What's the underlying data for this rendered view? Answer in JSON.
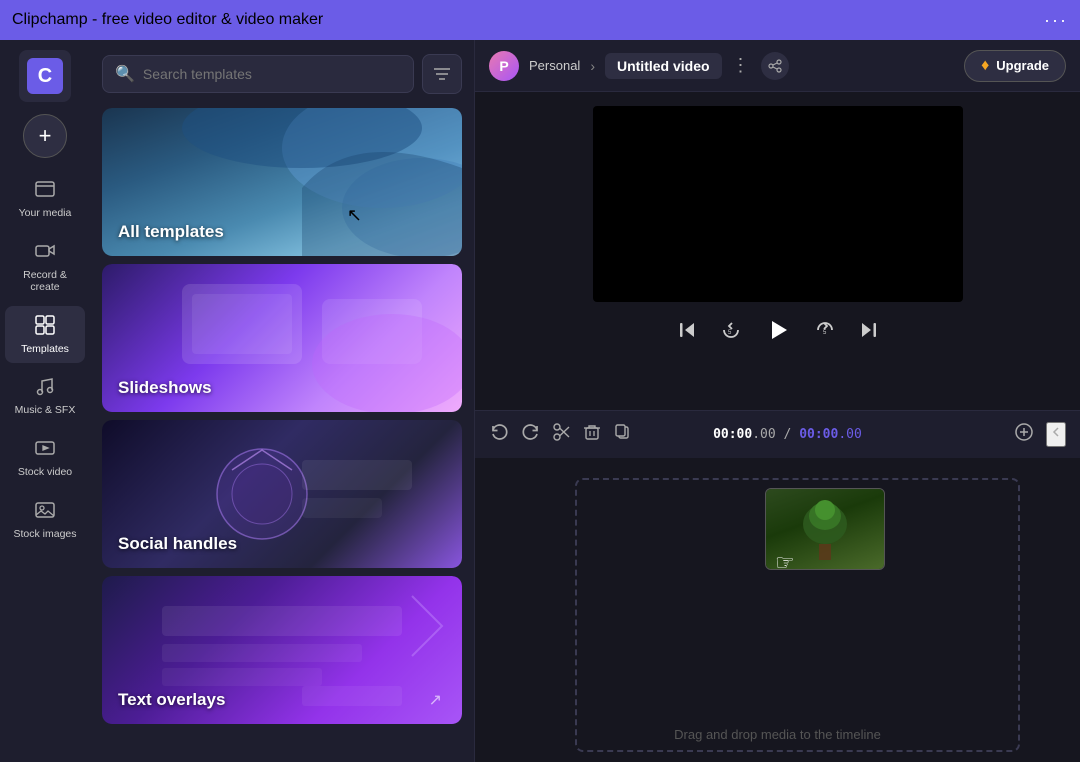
{
  "titlebar": {
    "title": "Clipchamp - free video editor & video maker",
    "dots": "···"
  },
  "sidebar": {
    "logo_letter": "C",
    "create_label": "+",
    "items": [
      {
        "id": "your-media",
        "icon": "🗂",
        "label": "Your media"
      },
      {
        "id": "record-create",
        "icon": "🎬",
        "label": "Record &\ncreate"
      },
      {
        "id": "templates",
        "icon": "⊞",
        "label": "Templates",
        "active": true
      },
      {
        "id": "music-sfx",
        "icon": "♪",
        "label": "Music & SFX"
      },
      {
        "id": "stock-video",
        "icon": "🎞",
        "label": "Stock video"
      },
      {
        "id": "stock-images",
        "icon": "🖼",
        "label": "Stock images"
      }
    ]
  },
  "search": {
    "placeholder": "Search templates",
    "filter_icon": "≡"
  },
  "templates": [
    {
      "id": "all-templates",
      "label": "All templates",
      "gradient": "linear-gradient(135deg, #1a3a5c 0%, #3a6a8a 40%, #5a9abc 70%, #8ab4d0 100%)"
    },
    {
      "id": "slideshows",
      "label": "Slideshows",
      "gradient": "linear-gradient(135deg, #2d1b69 0%, #7c3aed 40%, #c084fc 70%, #e879f9 100%)"
    },
    {
      "id": "social-handles",
      "label": "Social handles",
      "gradient": "linear-gradient(135deg, #1a1a6e 0%, #4a4aae 30%, #a855f7 60%, #ec4899 90%)"
    },
    {
      "id": "text-overlays",
      "label": "Text overlays",
      "gradient": "linear-gradient(135deg, #1e1b4b 0%, #4c1d95 30%, #9333ea 60%, #7c3aed 90%)"
    }
  ],
  "header": {
    "personal_label": "Personal",
    "breadcrumb_arrow": "›",
    "video_title": "Untitled video",
    "share_icon": "↑",
    "upgrade_label": "Upgrade",
    "diamond_icon": "♦"
  },
  "playback": {
    "skip_back_icon": "⏮",
    "rewind_icon": "↺",
    "play_icon": "▶",
    "forward_icon": "↻",
    "skip_forward_icon": "⏭"
  },
  "timeline": {
    "undo_icon": "↩",
    "redo_icon": "↪",
    "cut_icon": "✂",
    "delete_icon": "🗑",
    "copy_icon": "⧉",
    "current_time": "00:00",
    "current_ms": ".00",
    "separator": "/",
    "total_time": "00:00",
    "total_ms": ".00",
    "add_icon": "+",
    "collapse_icon": "‹"
  },
  "timeline_area": {
    "drag_hint": "Drag and drop media to the timeline"
  }
}
